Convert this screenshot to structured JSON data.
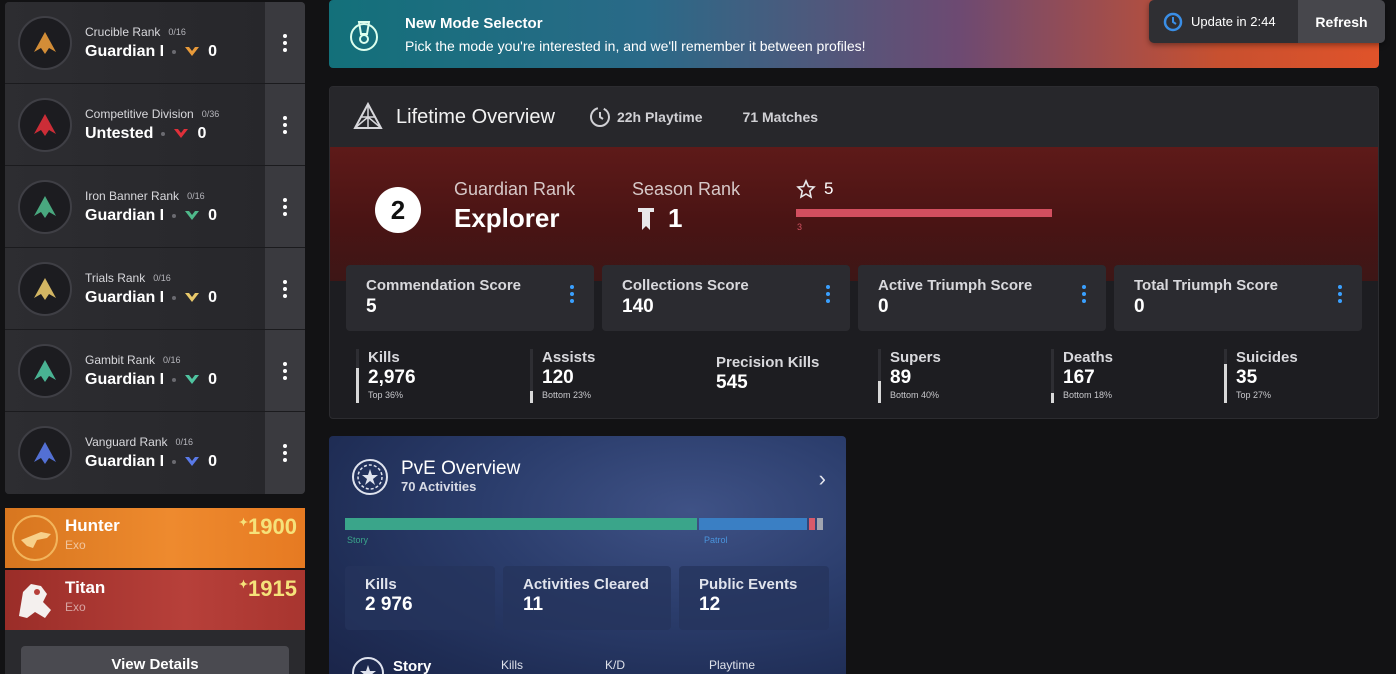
{
  "sidebar": {
    "ranks": [
      {
        "title": "Crucible Rank",
        "count": "0/16",
        "rank": "Guardian I",
        "value": "0",
        "color": "#e89a3a"
      },
      {
        "title": "Competitive Division",
        "count": "0/36",
        "rank": "Untested",
        "value": "0",
        "color": "#e0303a"
      },
      {
        "title": "Iron Banner Rank",
        "count": "0/16",
        "rank": "Guardian I",
        "value": "0",
        "color": "#4fb88a"
      },
      {
        "title": "Trials Rank",
        "count": "0/16",
        "rank": "Guardian I",
        "value": "0",
        "color": "#e8c86a"
      },
      {
        "title": "Gambit Rank",
        "count": "0/16",
        "rank": "Guardian I",
        "value": "0",
        "color": "#4fc4a0"
      },
      {
        "title": "Vanguard Rank",
        "count": "0/16",
        "rank": "Guardian I",
        "value": "0",
        "color": "#5a7ae8"
      }
    ],
    "characters": [
      {
        "name": "Hunter",
        "race": "Exo",
        "light": "1900",
        "color": "#ee8a2e"
      },
      {
        "name": "Titan",
        "race": "Exo",
        "light": "1915",
        "color": "#b7403a"
      }
    ],
    "view_details": "View Details"
  },
  "banner": {
    "title": "New Mode Selector",
    "text": "Pick the mode you're interested in, and we'll remember it between profiles!"
  },
  "update": {
    "label": "Update in 2:44",
    "refresh": "Refresh"
  },
  "lifetime": {
    "title": "Lifetime Overview",
    "playtime": "22h Playtime",
    "matches": "71 Matches",
    "guardian_rank_number": "2",
    "guardian_rank_label": "Guardian Rank",
    "guardian_rank_value": "Explorer",
    "season_rank_label": "Season Rank",
    "season_rank_value": "1",
    "star_value": "5",
    "progress_label": "3",
    "progress_fraction": 1.0,
    "scores": [
      {
        "label": "Commendation Score",
        "value": "5"
      },
      {
        "label": "Collections Score",
        "value": "140"
      },
      {
        "label": "Active Triumph Score",
        "value": "0"
      },
      {
        "label": "Total Triumph Score",
        "value": "0"
      }
    ],
    "stats": [
      {
        "label": "Kills",
        "value": "2,976",
        "pct": "Top 36%",
        "fill": 0.64
      },
      {
        "label": "Assists",
        "value": "120",
        "pct": "Bottom 23%",
        "fill": 0.23
      },
      {
        "label": "Precision Kills",
        "value": "545",
        "pct": "",
        "fill": 0
      },
      {
        "label": "Supers",
        "value": "89",
        "pct": "Bottom 40%",
        "fill": 0.4
      },
      {
        "label": "Deaths",
        "value": "167",
        "pct": "Bottom 18%",
        "fill": 0.18
      },
      {
        "label": "Suicides",
        "value": "35",
        "pct": "Top 27%",
        "fill": 0.73
      }
    ]
  },
  "pve": {
    "title": "PvE Overview",
    "subtitle": "70 Activities",
    "segments": [
      {
        "name": "Story",
        "fraction": 0.736,
        "color": "#3aa58a"
      },
      {
        "name": "Patrol",
        "fraction": 0.226,
        "color": "#3a7fc4"
      },
      {
        "name": "",
        "fraction": 0.012,
        "color": "#d85a6a"
      },
      {
        "name": "",
        "fraction": 0.014,
        "color": "#a0a4b0"
      }
    ],
    "legend_story": "Story",
    "legend_patrol": "Patrol",
    "cards": [
      {
        "label": "Kills",
        "value": "2 976"
      },
      {
        "label": "Activities Cleared",
        "value": "11"
      },
      {
        "label": "Public Events",
        "value": "12"
      }
    ],
    "story_row": {
      "name": "Story",
      "col_kills": "Kills",
      "col_kd": "K/D",
      "col_playtime": "Playtime"
    }
  }
}
